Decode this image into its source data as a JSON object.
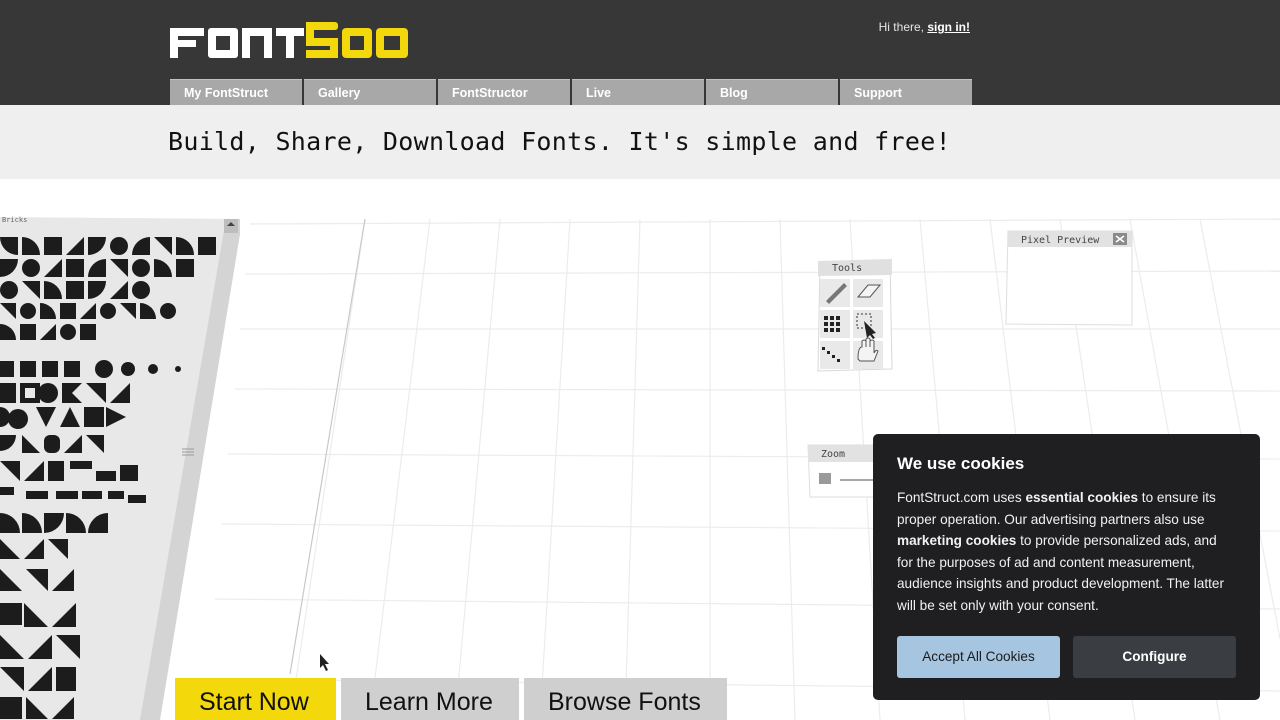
{
  "header": {
    "logo_text": "FONTSTRUCT",
    "greeting": "Hi there, ",
    "signin_label": "sign in!"
  },
  "nav": {
    "items": [
      {
        "label": "My FontStruct"
      },
      {
        "label": "Gallery"
      },
      {
        "label": "FontStructor"
      },
      {
        "label": "Live"
      },
      {
        "label": "Blog"
      },
      {
        "label": "Support"
      }
    ]
  },
  "tagline": "Build, Share, Download Fonts. It's simple and free!",
  "editor": {
    "bricks_label": "Bricks",
    "tools_label": "Tools",
    "zoom_label": "Zoom",
    "preview_label": "Pixel Preview"
  },
  "cta": {
    "start_label": "Start Now",
    "learn_label": "Learn More",
    "browse_label": "Browse Fonts"
  },
  "cookie": {
    "title": "We use cookies",
    "p1": "FontStruct.com uses ",
    "b1": "essential cookies",
    "p2": " to ensure its proper operation. Our advertising partners also use ",
    "b2": "marketing cookies",
    "p3": " to provide personalized ads, and for the purposes of ad and content measurement, audience insights and product development. The latter will be set only with your consent.",
    "accept_label": "Accept All Cookies",
    "config_label": "Configure"
  },
  "colors": {
    "header_bg": "#373737",
    "logo_accent": "#f3d80b",
    "nav_bg": "#a8a8a8",
    "start_button": "#f3d80b",
    "cookie_bg": "#1f1f22",
    "accept_bg": "#a6c5e0"
  }
}
